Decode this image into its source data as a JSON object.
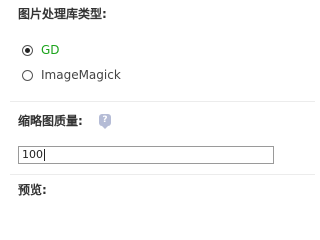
{
  "library_section": {
    "title": "图片处理库类型:",
    "options": [
      {
        "label": "GD",
        "checked": true,
        "color": "#1aa31a"
      },
      {
        "label": "ImageMagick",
        "checked": false,
        "color": "#444444"
      }
    ]
  },
  "thumbnail_section": {
    "title": "缩略图质量:",
    "help_icon": "question-bubble-icon",
    "help_glyph": "?",
    "quality_value": "100"
  },
  "preview_section": {
    "title": "预览:"
  }
}
